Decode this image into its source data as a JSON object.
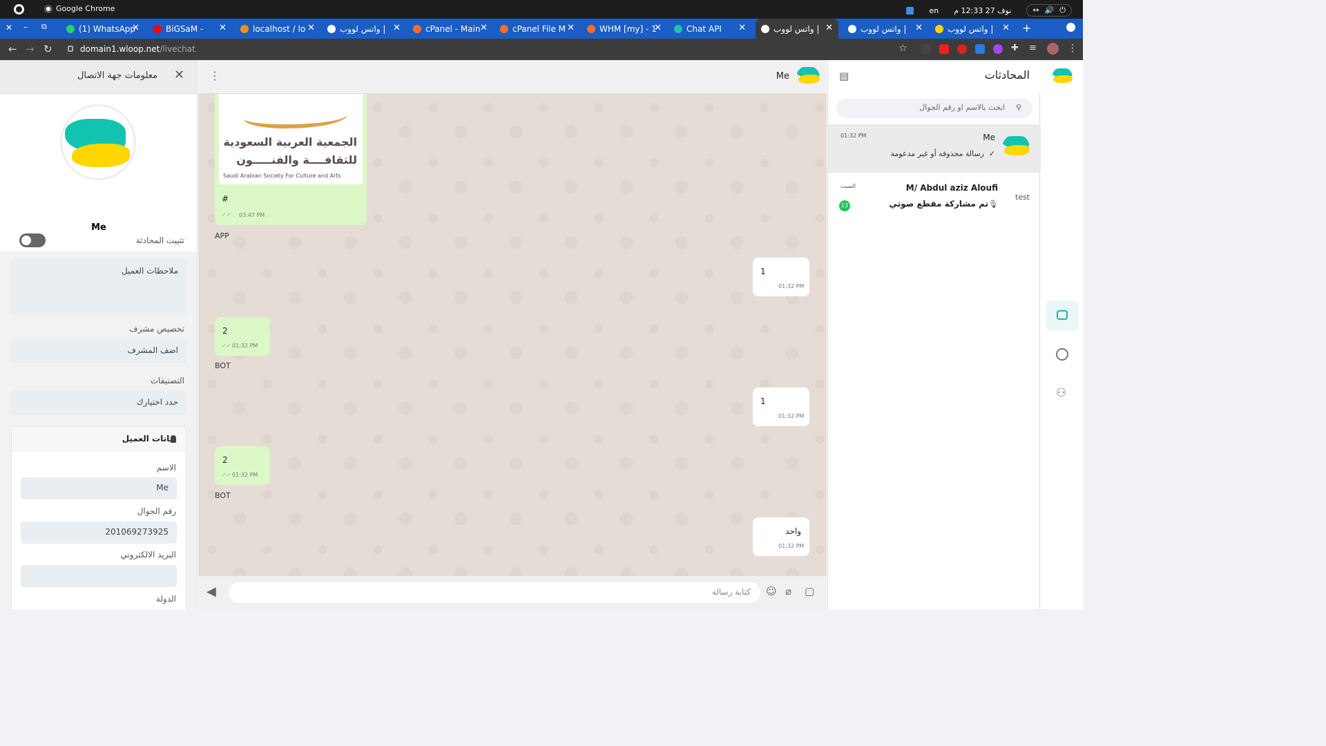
{
  "os": {
    "app_name": "Google Chrome",
    "lang": "en",
    "datetime": "نوف 27  12:33 م"
  },
  "tabs": [
    {
      "label": "(1) WhatsApp",
      "color": "#25d366"
    },
    {
      "label": "BiGSaM -",
      "color": "#ff0000"
    },
    {
      "label": "localhost / lo",
      "color": "#f29111"
    },
    {
      "label": "واتس لووب |",
      "color": "#ffffff"
    },
    {
      "label": "cPanel - Main",
      "color": "#ff6c2c"
    },
    {
      "label": "cPanel File M",
      "color": "#ff6c2c"
    },
    {
      "label": "WHM [my] - 1",
      "color": "#ff6c2c"
    },
    {
      "label": "Chat API",
      "color": "#17c3b2"
    },
    {
      "label": "واتس لووب |",
      "color": "#ffffff"
    },
    {
      "label": "واتس لووب |",
      "color": "#ffffff"
    },
    {
      "label": "واتس لووب |",
      "color": "#ffd600"
    }
  ],
  "url": {
    "host": "domain1.wloop.net",
    "path": "/livechat"
  },
  "contact": {
    "title": "معلومات جهة الاتصال",
    "name": "Me",
    "pin_label": "تثبيت المحادثة",
    "notes_placeholder": "ملاحظات العميل",
    "assign_label": "تخصيص مشرف",
    "assign_value": "اضف المشرف",
    "tags_label": "التصنيفات",
    "tags_value": "حدد اختيارك",
    "customer_header": "بيانات العميل",
    "name_label": "الاسم",
    "name_value": "Me",
    "phone_label": "رقم الجوال",
    "phone_value": "201069273925",
    "email_label": "البريد الالكتروني",
    "email_value": "",
    "country_label": "الدولة"
  },
  "chat": {
    "header_name": "Me",
    "image_text_ar1": "الجمعية العربية السعودية",
    "image_text_ar2": "للثقافــــة والفنـــــون",
    "image_text_en": "Saudi Arabian Society For Culture and Arts",
    "messages": [
      {
        "dir": "in",
        "text": "#",
        "time": "03:47 PM",
        "sender": "APP"
      },
      {
        "dir": "out",
        "text": "1",
        "time": "01:32 PM"
      },
      {
        "dir": "in",
        "text": "2",
        "time": "01:32 PM",
        "sender": "BOT"
      },
      {
        "dir": "out",
        "text": "1",
        "time": "01:32 PM"
      },
      {
        "dir": "in",
        "text": "2",
        "time": "01:32 PM",
        "sender": "BOT"
      },
      {
        "dir": "out",
        "text": "واحد",
        "time": "01:32 PM"
      }
    ],
    "compose_placeholder": "كتابة رسالة"
  },
  "convs": {
    "title": "المحادثات",
    "search_placeholder": "ابحث بالاسم او رقم الجوال",
    "items": [
      {
        "name": "Me",
        "time": "01:32 PM",
        "preview": "رسالة محذوفه أو غير مدعومة",
        "check": "✓"
      },
      {
        "name": "M/ Abdul aziz Aloufi",
        "time": "السبت",
        "preview": "تم مشاركة مقطع صوتي",
        "badge": "13",
        "img_alt": "test"
      }
    ]
  }
}
